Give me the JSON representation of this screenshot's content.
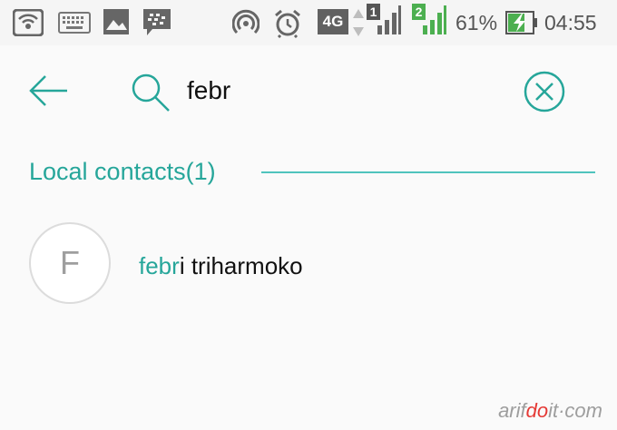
{
  "status_bar": {
    "signal_type": "4G",
    "sim1_badge": "1",
    "sim2_badge": "2",
    "battery_percent": "61%",
    "battery_level": 0.61,
    "time": "04:55",
    "colors": {
      "sim2": "#4caf50",
      "battery_charging": "#4caf50",
      "text": "#555555"
    },
    "icons": [
      "wifi-hotspot-icon",
      "keyboard-icon",
      "image-icon",
      "bbm-icon",
      "hotspot-icon",
      "alarm-icon",
      "signal-icon",
      "battery-charging-icon"
    ]
  },
  "toolbar": {
    "search_query": "febr",
    "search_placeholder": "",
    "icons": [
      "back-arrow-icon",
      "search-icon",
      "clear-icon"
    ]
  },
  "section": {
    "title": "Local contacts(1)"
  },
  "contacts": [
    {
      "initial": "F",
      "match": "febr",
      "rest": "i triharmoko"
    }
  ],
  "watermark": {
    "part1": "arif",
    "part2": "do",
    "part3": "it",
    "part4": "·com"
  },
  "theme": {
    "accent": "#26a69a",
    "avatar_border": "#dcdcdc"
  }
}
